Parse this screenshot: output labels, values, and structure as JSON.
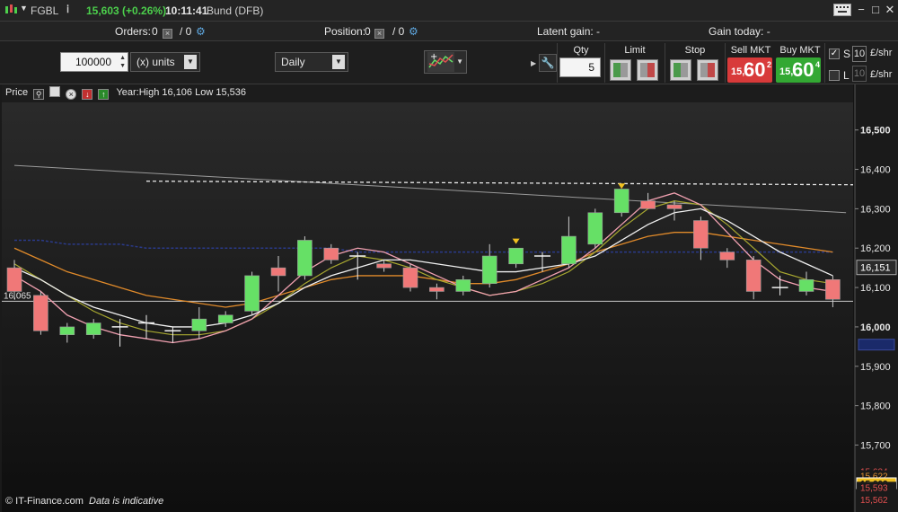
{
  "titlebar": {
    "symbol": "FGBL",
    "info_icon": "info-icon",
    "price": "15,603 (+0.26%)",
    "time": "10:11:41",
    "name": "Bund (DFB)"
  },
  "infobar": {
    "orders_label": "Orders:",
    "orders_a": "0",
    "orders_b": "/ 0",
    "position_label": "Position:",
    "position_a": "0",
    "position_b": "/ 0",
    "latent_gain": "Latent gain:  -",
    "gain_today": "Gain today:  -"
  },
  "toolbar": {
    "quantity_value": "100000",
    "units_label": "(x) units",
    "period_value": "Daily",
    "qty_label": "Qty",
    "qty_value": "5",
    "limit_label": "Limit",
    "stop_label": "Stop",
    "sell_label": "Sell MKT",
    "buy_label": "Buy MKT",
    "sell_small": "15,",
    "sell_big": "60",
    "sell_sup": "2",
    "buy_small": "15,",
    "buy_big": "60",
    "buy_sup": "4",
    "s_label": "S",
    "l_label": "L",
    "s_count": "10",
    "l_count": "10",
    "unit_s": "£/shr",
    "unit_l": "£/shr"
  },
  "chart": {
    "price_label": "Price",
    "year_info": "Year:High 16,106 Low 15,536",
    "credit": "© IT-Finance.com",
    "indicative": "Data is indicative",
    "left_marker": "16,065"
  },
  "colors": {
    "up": "#66e066",
    "down": "#f07878",
    "sell_bg": "#d83a3a",
    "buy_bg": "#33a833",
    "last_badge": "#f0c020"
  },
  "chart_data": {
    "type": "candlestick",
    "ylim": [
      15.53,
      16.57
    ],
    "y_ticks": [
      "16,500",
      "16,400",
      "16,300",
      "16,200",
      "16,100",
      "16,000",
      "15,900",
      "15,800",
      "15,700"
    ],
    "y_tick_values": [
      16.5,
      16.4,
      16.3,
      16.2,
      16.1,
      16.0,
      15.9,
      15.8,
      15.7
    ],
    "current_price": "16,151",
    "current_value": 16.151,
    "bottom_labels": [
      {
        "text": "15,634",
        "value": 15.634,
        "color": "#e05050"
      },
      {
        "text": "15,622",
        "value": 15.622,
        "color": "#e09030"
      },
      {
        "text": "15,603",
        "value": 15.603,
        "color": "#f0c020"
      },
      {
        "text": "15,593",
        "value": 15.593,
        "color": "#e05050"
      },
      {
        "text": "15,562",
        "value": 15.562,
        "color": "#e05050"
      }
    ],
    "candles": [
      {
        "o": 16.15,
        "h": 16.17,
        "l": 16.07,
        "c": 16.09
      },
      {
        "o": 16.08,
        "h": 16.09,
        "l": 15.98,
        "c": 15.99
      },
      {
        "o": 15.98,
        "h": 16.01,
        "l": 15.96,
        "c": 16.0
      },
      {
        "o": 15.98,
        "h": 16.02,
        "l": 15.97,
        "c": 16.01
      },
      {
        "o": 16.0,
        "h": 16.02,
        "l": 15.95,
        "c": 16.0
      },
      {
        "o": 16.01,
        "h": 16.03,
        "l": 15.97,
        "c": 16.01
      },
      {
        "o": 15.99,
        "h": 16.0,
        "l": 15.96,
        "c": 15.99
      },
      {
        "o": 15.99,
        "h": 16.05,
        "l": 15.97,
        "c": 16.02
      },
      {
        "o": 16.01,
        "h": 16.04,
        "l": 16.0,
        "c": 16.03
      },
      {
        "o": 16.04,
        "h": 16.14,
        "l": 16.03,
        "c": 16.13
      },
      {
        "o": 16.15,
        "h": 16.18,
        "l": 16.09,
        "c": 16.13
      },
      {
        "o": 16.13,
        "h": 16.23,
        "l": 16.12,
        "c": 16.22
      },
      {
        "o": 16.2,
        "h": 16.21,
        "l": 16.16,
        "c": 16.17
      },
      {
        "o": 16.18,
        "h": 16.19,
        "l": 16.12,
        "c": 16.18
      },
      {
        "o": 16.16,
        "h": 16.17,
        "l": 16.14,
        "c": 16.15
      },
      {
        "o": 16.15,
        "h": 16.16,
        "l": 16.09,
        "c": 16.1
      },
      {
        "o": 16.1,
        "h": 16.11,
        "l": 16.07,
        "c": 16.09
      },
      {
        "o": 16.09,
        "h": 16.13,
        "l": 16.08,
        "c": 16.12
      },
      {
        "o": 16.11,
        "h": 16.21,
        "l": 16.1,
        "c": 16.18
      },
      {
        "o": 16.16,
        "h": 16.2,
        "l": 16.15,
        "c": 16.2
      },
      {
        "o": 16.18,
        "h": 16.19,
        "l": 16.14,
        "c": 16.18
      },
      {
        "o": 16.16,
        "h": 16.28,
        "l": 16.15,
        "c": 16.23
      },
      {
        "o": 16.21,
        "h": 16.3,
        "l": 16.2,
        "c": 16.29
      },
      {
        "o": 16.29,
        "h": 16.35,
        "l": 16.28,
        "c": 16.35
      },
      {
        "o": 16.32,
        "h": 16.34,
        "l": 16.3,
        "c": 16.3
      },
      {
        "o": 16.31,
        "h": 16.32,
        "l": 16.27,
        "c": 16.3
      },
      {
        "o": 16.27,
        "h": 16.28,
        "l": 16.17,
        "c": 16.2
      },
      {
        "o": 16.19,
        "h": 16.2,
        "l": 16.15,
        "c": 16.17
      },
      {
        "o": 16.17,
        "h": 16.18,
        "l": 16.07,
        "c": 16.09
      },
      {
        "o": 16.1,
        "h": 16.13,
        "l": 16.08,
        "c": 16.1
      },
      {
        "o": 16.09,
        "h": 16.14,
        "l": 16.08,
        "c": 16.12
      },
      {
        "o": 16.12,
        "h": 16.13,
        "l": 16.05,
        "c": 16.07
      }
    ],
    "signals": [
      {
        "index": 19,
        "value": 16.215
      },
      {
        "index": 23,
        "value": 16.355
      }
    ],
    "ma_pink": [
      16.13,
      16.09,
      16.03,
      16.0,
      15.98,
      15.97,
      15.96,
      15.97,
      15.99,
      16.02,
      16.08,
      16.14,
      16.18,
      16.2,
      16.19,
      16.16,
      16.13,
      16.1,
      16.08,
      16.09,
      16.12,
      16.15,
      16.2,
      16.26,
      16.32,
      16.34,
      16.31,
      16.24,
      16.17,
      16.12,
      16.1,
      16.09
    ],
    "ma_olive": [
      16.16,
      16.12,
      16.08,
      16.04,
      16.01,
      15.99,
      15.98,
      15.98,
      15.99,
      16.02,
      16.06,
      16.11,
      16.15,
      16.18,
      16.17,
      16.15,
      16.12,
      16.1,
      16.08,
      16.09,
      16.11,
      16.14,
      16.19,
      16.25,
      16.3,
      16.32,
      16.31,
      16.26,
      16.2,
      16.14,
      16.12,
      16.11
    ],
    "ma_white": [
      16.15,
      16.12,
      16.08,
      16.05,
      16.03,
      16.01,
      16.0,
      16.0,
      16.01,
      16.03,
      16.06,
      16.1,
      16.13,
      16.15,
      16.17,
      16.17,
      16.16,
      16.15,
      16.14,
      16.14,
      16.15,
      16.16,
      16.18,
      16.22,
      16.26,
      16.29,
      16.3,
      16.27,
      16.23,
      16.19,
      16.16,
      16.13
    ],
    "ma_orange": [
      16.2,
      16.17,
      16.14,
      16.12,
      16.1,
      16.08,
      16.07,
      16.06,
      16.05,
      16.06,
      16.08,
      16.1,
      16.12,
      16.13,
      16.13,
      16.13,
      16.12,
      16.11,
      16.11,
      16.12,
      16.14,
      16.16,
      16.19,
      16.21,
      16.23,
      16.24,
      16.24,
      16.23,
      16.22,
      16.21,
      16.2,
      16.19
    ],
    "ma_navy": [
      16.22,
      16.22,
      16.21,
      16.21,
      16.21,
      16.2,
      16.2,
      16.2,
      16.2,
      16.2,
      16.2,
      16.2,
      16.2,
      16.19,
      16.19,
      16.19,
      16.19,
      16.19,
      16.19,
      16.19,
      16.19,
      16.19,
      16.19,
      16.19,
      16.19,
      16.19,
      16.19,
      16.19,
      16.19,
      16.19,
      16.19,
      16.19
    ],
    "trendline": [
      [
        0,
        16.41
      ],
      [
        31.5,
        16.29
      ]
    ],
    "resistance": 16.37,
    "support": 16.065
  }
}
